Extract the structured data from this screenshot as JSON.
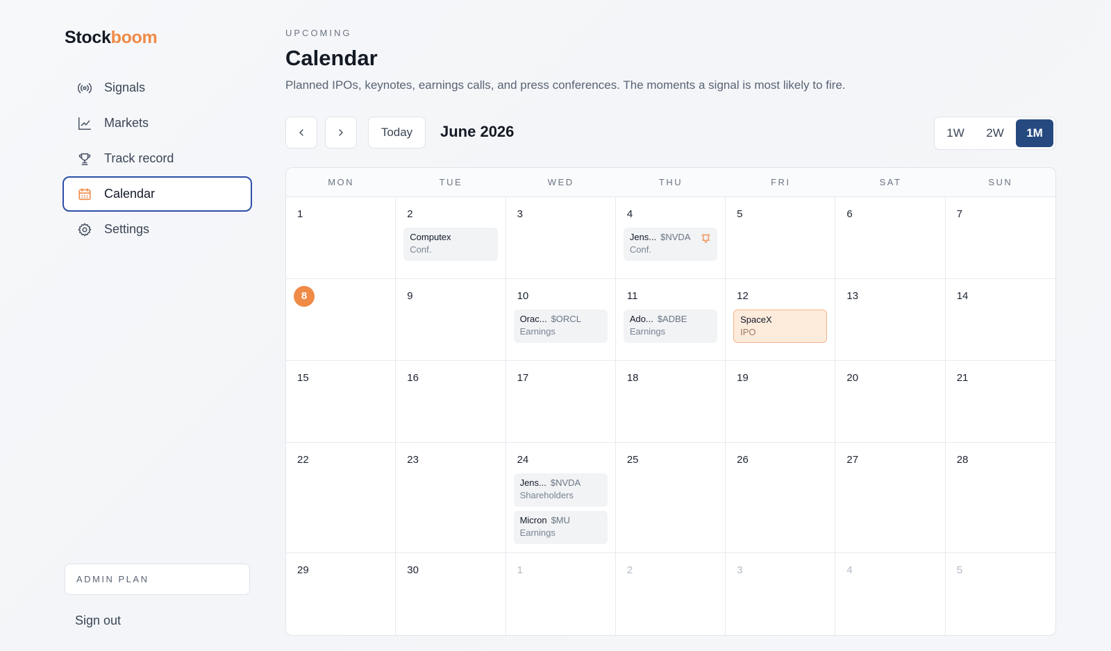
{
  "brand": {
    "part1": "Stock",
    "part2": "boom"
  },
  "sidebar": {
    "items": [
      {
        "label": "Signals",
        "icon": "broadcast-icon"
      },
      {
        "label": "Markets",
        "icon": "line-chart-icon"
      },
      {
        "label": "Track record",
        "icon": "trophy-icon"
      },
      {
        "label": "Calendar",
        "icon": "calendar-icon",
        "active": true
      },
      {
        "label": "Settings",
        "icon": "gear-icon"
      }
    ],
    "plan": "ADMIN PLAN",
    "signout": "Sign out"
  },
  "header": {
    "eyebrow": "UPCOMING",
    "title": "Calendar",
    "subtitle": "Planned IPOs, keynotes, earnings calls, and press conferences. The moments a signal is most likely to fire."
  },
  "toolbar": {
    "today": "Today",
    "month": "June 2026",
    "ranges": [
      "1W",
      "2W",
      "1M"
    ],
    "active_range": "1M"
  },
  "calendar": {
    "weekdays": [
      "MON",
      "TUE",
      "WED",
      "THU",
      "FRI",
      "SAT",
      "SUN"
    ],
    "today": "8",
    "weeks": [
      [
        {
          "day": "1",
          "events": []
        },
        {
          "day": "2",
          "events": [
            {
              "name": "Computex",
              "ticker": "",
              "type": "Conf."
            }
          ]
        },
        {
          "day": "3",
          "events": []
        },
        {
          "day": "4",
          "events": [
            {
              "name": "Jens...",
              "ticker": "$NVDA",
              "type": "Conf.",
              "bell": true
            }
          ]
        },
        {
          "day": "5",
          "events": []
        },
        {
          "day": "6",
          "events": []
        },
        {
          "day": "7",
          "events": []
        }
      ],
      [
        {
          "day": "8",
          "events": []
        },
        {
          "day": "9",
          "events": []
        },
        {
          "day": "10",
          "events": [
            {
              "name": "Orac...",
              "ticker": "$ORCL",
              "type": "Earnings"
            }
          ]
        },
        {
          "day": "11",
          "events": [
            {
              "name": "Ado...",
              "ticker": "$ADBE",
              "type": "Earnings"
            }
          ]
        },
        {
          "day": "12",
          "events": [
            {
              "name": "SpaceX",
              "ticker": "",
              "type": "IPO",
              "highlight": true
            }
          ]
        },
        {
          "day": "13",
          "events": []
        },
        {
          "day": "14",
          "events": []
        }
      ],
      [
        {
          "day": "15",
          "events": []
        },
        {
          "day": "16",
          "events": []
        },
        {
          "day": "17",
          "events": []
        },
        {
          "day": "18",
          "events": []
        },
        {
          "day": "19",
          "events": []
        },
        {
          "day": "20",
          "events": []
        },
        {
          "day": "21",
          "events": []
        }
      ],
      [
        {
          "day": "22",
          "events": []
        },
        {
          "day": "23",
          "events": []
        },
        {
          "day": "24",
          "events": [
            {
              "name": "Jens...",
              "ticker": "$NVDA",
              "type": "Shareholders"
            },
            {
              "name": "Micron",
              "ticker": "$MU",
              "type": "Earnings"
            }
          ]
        },
        {
          "day": "25",
          "events": []
        },
        {
          "day": "26",
          "events": []
        },
        {
          "day": "27",
          "events": []
        },
        {
          "day": "28",
          "events": []
        }
      ],
      [
        {
          "day": "29",
          "events": []
        },
        {
          "day": "30",
          "events": []
        },
        {
          "day": "1",
          "muted": true,
          "events": []
        },
        {
          "day": "2",
          "muted": true,
          "events": []
        },
        {
          "day": "3",
          "muted": true,
          "events": []
        },
        {
          "day": "4",
          "muted": true,
          "events": []
        },
        {
          "day": "5",
          "muted": true,
          "events": []
        }
      ]
    ]
  },
  "colors": {
    "accent": "#ef8a47",
    "active_border": "#2d4ea8",
    "segment_active": "#264a80"
  }
}
